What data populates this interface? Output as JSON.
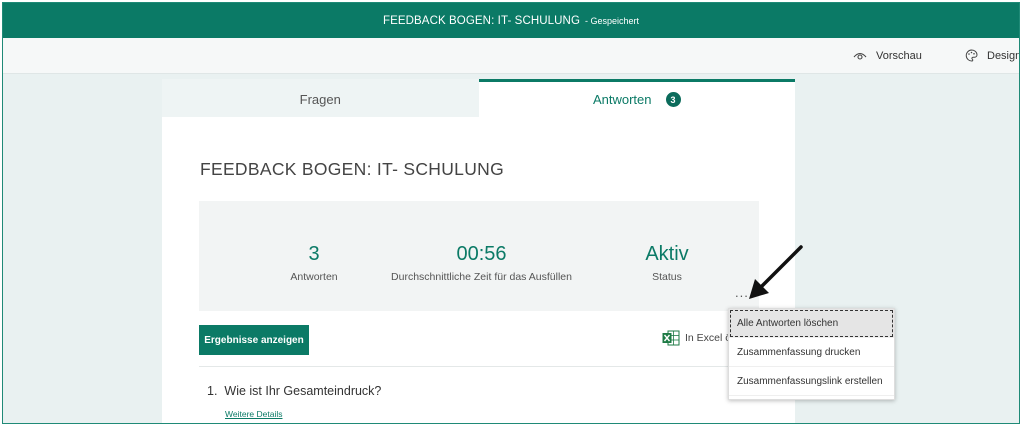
{
  "header": {
    "title": "FEEDBACK BOGEN: IT- SCHULUNG",
    "saved": "- Gespeichert"
  },
  "toolbar": {
    "preview_label": "Vorschau",
    "design_label": "Design"
  },
  "tabs": [
    {
      "label": "Fragen"
    },
    {
      "label": "Antworten",
      "badge": "3"
    }
  ],
  "form": {
    "title": "FEEDBACK BOGEN: IT- SCHULUNG"
  },
  "stats": [
    {
      "value": "3",
      "label": "Antworten"
    },
    {
      "value": "00:56",
      "label": "Durchschnittliche Zeit für das Ausfüllen"
    },
    {
      "value": "Aktiv",
      "label": "Status"
    }
  ],
  "actions": {
    "results_button": "Ergebnisse anzeigen",
    "excel_label": "In Excel öffnen",
    "more": "..."
  },
  "questions": [
    {
      "number": "1.",
      "text": "Wie ist Ihr Gesamteindruck?",
      "details_link": "Weitere Details"
    }
  ],
  "menu": {
    "items": [
      {
        "label": "Alle Antworten löschen"
      },
      {
        "label": "Zusammenfassung drucken"
      },
      {
        "label": "Zusammenfassungslink erstellen"
      }
    ]
  },
  "colors": {
    "accent": "#0b7a66",
    "background": "#e9f1f1"
  }
}
